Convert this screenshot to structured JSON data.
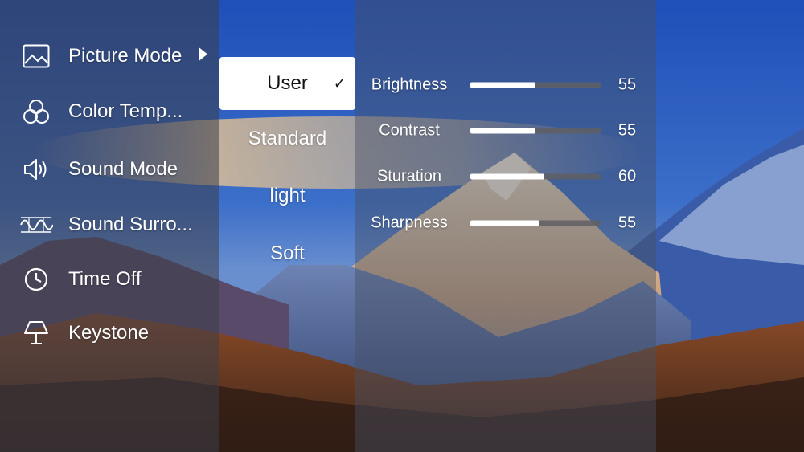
{
  "menu": {
    "items": [
      {
        "label": "Picture Mode",
        "icon": "picture-icon",
        "has_arrow": true
      },
      {
        "label": "Color Temp...",
        "icon": "color-circles-icon"
      },
      {
        "label": "Sound Mode",
        "icon": "speaker-icon"
      },
      {
        "label": "Sound Surro...",
        "icon": "surround-wave-icon"
      },
      {
        "label": "Time Off",
        "icon": "clock-icon"
      },
      {
        "label": "Keystone",
        "icon": "lamp-icon"
      }
    ]
  },
  "picture_modes": {
    "selected": "User",
    "check": "✓",
    "options": [
      "User",
      "Standard",
      "light",
      "Soft"
    ]
  },
  "adjustments": [
    {
      "label": "Brightness",
      "value": "55",
      "level": 0.5
    },
    {
      "label": "Contrast",
      "value": "55",
      "level": 0.5
    },
    {
      "label": "Sturation",
      "value": "60",
      "level": 0.57
    },
    {
      "label": "Sharpness",
      "value": "55",
      "level": 0.53
    }
  ],
  "colors": {
    "accent": "#ffffff",
    "selected_bg": "#ffffff",
    "track": "#5f5f64"
  }
}
